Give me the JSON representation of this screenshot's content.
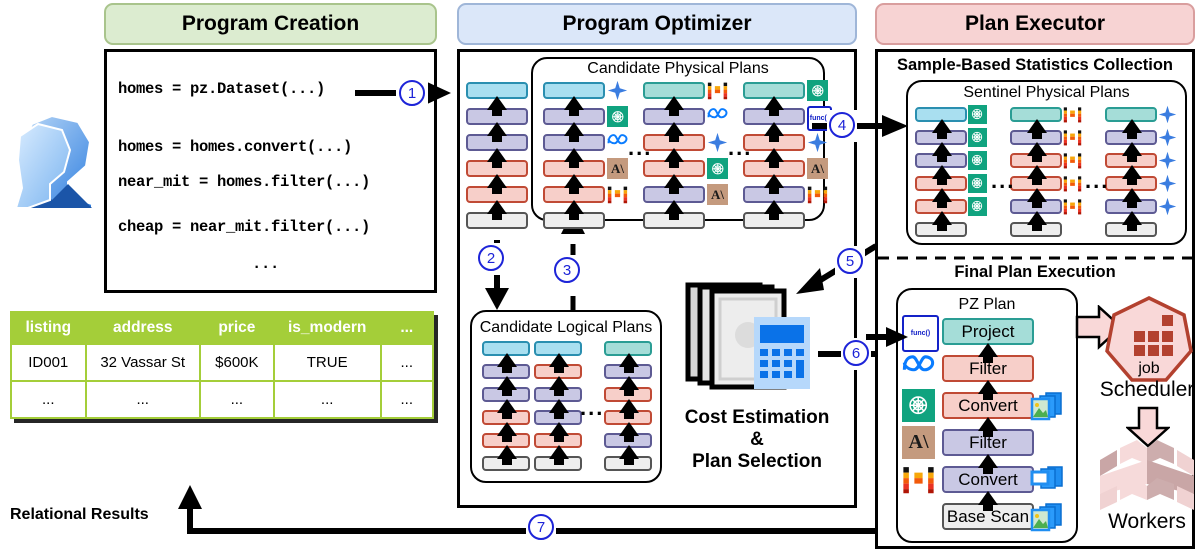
{
  "panels": {
    "creation": {
      "title": "Program Creation"
    },
    "optimizer": {
      "title": "Program Optimizer"
    },
    "executor": {
      "title": "Plan Executor"
    }
  },
  "code": {
    "lines": [
      "homes = pz.Dataset(...)",
      "homes = homes.convert(...)",
      "near_mit = homes.filter(...)",
      "cheap = near_mit.filter(...)",
      "..."
    ]
  },
  "results_table": {
    "caption": "Relational Results",
    "columns": [
      "listing",
      "address",
      "price",
      "is_modern",
      "..."
    ],
    "rows": [
      [
        "ID001",
        "32 Vassar St",
        "$600K",
        "TRUE",
        "..."
      ],
      [
        "...",
        "...",
        "...",
        "...",
        "..."
      ]
    ]
  },
  "optimizer": {
    "physical_plans_label": "Candidate Physical Plans",
    "logical_plans_label": "Candidate Logical Plans",
    "cost_line1": "Cost Estimation",
    "cost_line2": "&",
    "cost_line3": "Plan Selection",
    "input_plan": [
      "cyan",
      "purple",
      "purple",
      "red",
      "red",
      "gray"
    ],
    "physical_columns": [
      {
        "nodes": [
          "cyan",
          "purple",
          "purple",
          "red",
          "red",
          "gray"
        ],
        "badges": [
          "sparkle",
          "openai",
          "meta",
          "anthropic",
          "mistral",
          null
        ]
      },
      {
        "nodes": [
          "teal",
          "purple",
          "red",
          "red",
          "purple",
          "gray"
        ],
        "badges": [
          "mistral",
          "meta",
          "sparkle",
          "openai",
          "anthropic",
          null
        ]
      },
      {
        "nodes": [
          "teal",
          "purple",
          "red",
          "red",
          "purple",
          "gray"
        ],
        "badges": [
          "openai",
          "func",
          "sparkle",
          "anthropic",
          "mistral",
          null
        ]
      }
    ],
    "logical_columns": [
      {
        "nodes": [
          "cyan",
          "purple",
          "purple",
          "red",
          "red",
          "gray"
        ]
      },
      {
        "nodes": [
          "cyan",
          "red",
          "purple",
          "purple",
          "red",
          "gray"
        ]
      },
      {
        "nodes": [
          "teal",
          "purple",
          "red",
          "red",
          "purple",
          "gray"
        ]
      }
    ],
    "ellipsis": "..."
  },
  "executor": {
    "stats_label": "Sample-Based Statistics Collection",
    "sentinel_label": "Sentinel Physical Plans",
    "final_label": "Final Plan Execution",
    "pz_plan_label": "PZ Plan",
    "scheduler_label": "Scheduler",
    "workers_label": "Workers",
    "job_label": "job",
    "sentinel_columns": [
      {
        "nodes": [
          "cyan",
          "purple",
          "purple",
          "red",
          "red",
          "gray"
        ],
        "badge": "openai"
      },
      {
        "nodes": [
          "teal",
          "purple",
          "red",
          "red",
          "purple",
          "gray"
        ],
        "badge": "mistral"
      },
      {
        "nodes": [
          "teal",
          "purple",
          "red",
          "red",
          "purple",
          "gray"
        ],
        "badge": "sparkle"
      }
    ],
    "pz_plan_ops": [
      {
        "label": "Project",
        "color": "teal",
        "badge": "func",
        "data_icon": null
      },
      {
        "label": "Filter",
        "color": "red",
        "badge": "meta",
        "data_icon": null
      },
      {
        "label": "Convert",
        "color": "red",
        "badge": "openai",
        "data_icon": "images"
      },
      {
        "label": "Filter",
        "color": "purple",
        "badge": "anthropic",
        "data_icon": null
      },
      {
        "label": "Convert",
        "color": "purple",
        "badge": "mistral",
        "data_icon": "files"
      },
      {
        "label": "Base Scan",
        "color": "gray",
        "badge": null,
        "data_icon": "files-img"
      }
    ],
    "ellipsis": "..."
  },
  "steps": {
    "s1": "1",
    "s2": "2",
    "s3": "3",
    "s4": "4",
    "s5": "5",
    "s6": "6",
    "s7": "7"
  },
  "colors": {
    "green_header": "#dcecd0",
    "blue_header": "#dbe7f9",
    "pink_header": "#f7d3d3",
    "table_header": "#a4ce39",
    "step_blue": "#1d24d8",
    "openai_green": "#10a37f",
    "meta_blue": "#0a7cff",
    "anthropic_tan": "#c49a7e",
    "sparkle_blue": "#3b7de0"
  }
}
